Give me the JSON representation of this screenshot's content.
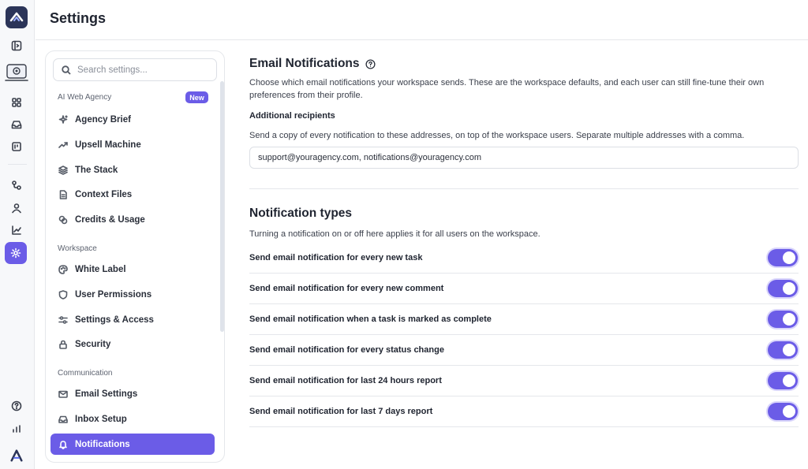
{
  "header": {
    "title": "Settings"
  },
  "search": {
    "placeholder": "Search settings..."
  },
  "groups": {
    "ai_web_agency": {
      "label": "AI Web Agency",
      "badge": "New"
    },
    "workspace": {
      "label": "Workspace"
    },
    "communication": {
      "label": "Communication"
    }
  },
  "nav": {
    "agency_brief": "Agency Brief",
    "upsell_machine": "Upsell Machine",
    "the_stack": "The Stack",
    "context_files": "Context Files",
    "credits_usage": "Credits & Usage",
    "white_label": "White Label",
    "user_permissions": "User Permissions",
    "settings_access": "Settings & Access",
    "security": "Security",
    "email_settings": "Email Settings",
    "inbox_setup": "Inbox Setup",
    "notifications": "Notifications"
  },
  "email_notifications": {
    "title": "Email Notifications",
    "description": "Choose which email notifications your workspace sends. These are the workspace defaults, and each user can still fine-tune their own preferences from their profile.",
    "recipients_label": "Additional recipients",
    "recipients_description": "Send a copy of every notification to these addresses, on top of the workspace users. Separate multiple addresses with a comma.",
    "recipients_value": "support@youragency.com, notifications@youragency.com"
  },
  "notification_types": {
    "title": "Notification types",
    "description": "Turning a notification on or off here applies it for all users on the workspace.",
    "items": [
      {
        "label": "Send email notification for every new task",
        "enabled": true
      },
      {
        "label": "Send email notification for every new comment",
        "enabled": true
      },
      {
        "label": "Send email notification when a task is marked as complete",
        "enabled": true
      },
      {
        "label": "Send email notification for every status change",
        "enabled": true
      },
      {
        "label": "Send email notification for last 24 hours report",
        "enabled": true
      },
      {
        "label": "Send email notification for last 7 days report",
        "enabled": true
      }
    ]
  },
  "colors": {
    "accent": "#6b5ce7",
    "logo_bg": "#2b3458"
  },
  "icons": {
    "rail": [
      "app-logo-icon",
      "sidebar-toggle-icon",
      "agent-icon",
      "grid-icon",
      "inbox-icon",
      "calendar-icon",
      "workflow-icon",
      "user-icon",
      "chart-icon",
      "gear-icon",
      "help-icon",
      "bar-chart-icon",
      "brand-icon"
    ]
  }
}
